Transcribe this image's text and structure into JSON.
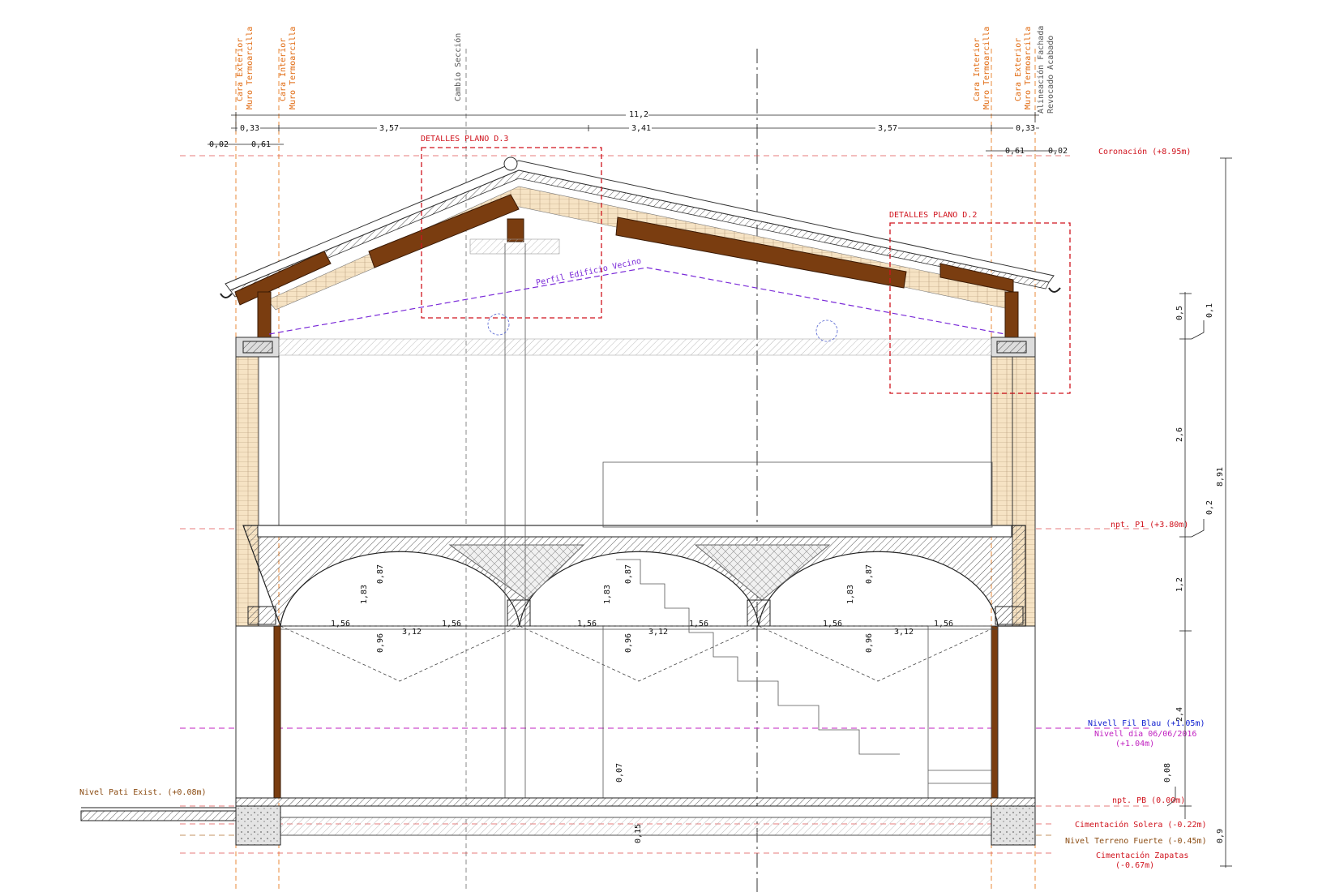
{
  "top_refs": {
    "ext_left": [
      "Cara Exterior",
      "Muro Termoarcilla"
    ],
    "int_left": [
      "Cara Interior",
      "Muro Termoarcilla"
    ],
    "section_change": "Cambio Sección",
    "int_right": [
      "Cara Interior",
      "Muro Termoarcilla"
    ],
    "ext_right": [
      "Cara Exterior",
      "Muro Termoarcilla"
    ],
    "facade": [
      "Alineación Fachada",
      "Revocado Acabado"
    ]
  },
  "top_dims": {
    "total": "11,2",
    "segments": [
      "0,33",
      "3,57",
      "3,41",
      "3,57",
      "0,33"
    ],
    "left_small": [
      "0,02",
      "0,61"
    ],
    "right_small": [
      "0,61",
      "0,02"
    ]
  },
  "details": {
    "d3": "DETALLES PLANO D.3",
    "d2": "DETALLES PLANO D.2"
  },
  "neighbor_profile": "Perfil Edificio Vecino",
  "levels": {
    "coronacion": "Coronación (+8.95m)",
    "p1": "npt. P1 (+3.80m)",
    "fil_blau": "Nivell Fil Blau (+1.05m)",
    "nivell_dia": [
      "Nivell dia 06/06/2016",
      "(+1.04m)"
    ],
    "pb": "npt. PB (0.00m)",
    "solera": "Cimentación Solera (-0.22m)",
    "terreno": "Nivel Terreno Fuerte (-0.45m)",
    "zapatas": [
      "Cimentación Zapatas",
      "(-0.67m)"
    ],
    "pati": "Nivel Pati Exist. (+0.08m)"
  },
  "vault_dims": {
    "half_span": "1,56",
    "span": "3,12",
    "height": "1,83",
    "rise": "0,87",
    "depth": "0,96"
  },
  "floor_dims": {
    "step": "0,07",
    "slab": "0,15"
  },
  "right_dims": {
    "a": "0,5",
    "b": "0,1",
    "c": "2,6",
    "d": "0,2",
    "e": "1,2",
    "f": "2,4",
    "g": "0,08",
    "h": "0,9",
    "total": "8,91"
  },
  "colors": {
    "timber": "#7a3d10",
    "level_red": "#d0141e",
    "ref_orange": "#e06a10",
    "fil_blau": "#1020d0",
    "nivell_dia": "#c020c0",
    "neighbor": "#7a2ad8"
  }
}
